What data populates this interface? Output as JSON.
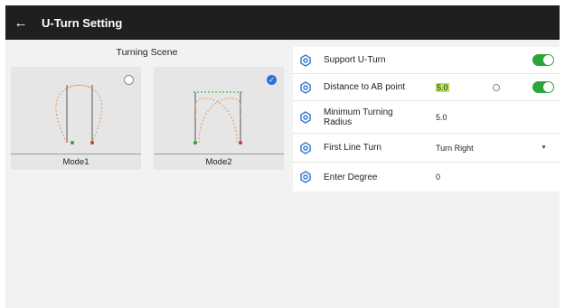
{
  "header": {
    "back_icon": "back-arrow-icon",
    "title": "U-Turn Setting"
  },
  "scene": {
    "title": "Turning Scene",
    "modes": [
      {
        "label": "Mode1",
        "selected": false
      },
      {
        "label": "Mode2",
        "selected": true
      }
    ]
  },
  "settings": {
    "support_uturn": {
      "label": "Support U-Turn",
      "enabled": true
    },
    "distance_ab": {
      "label": "Distance to AB point",
      "value": "5.0",
      "enabled": true
    },
    "min_radius": {
      "label": "Minimum Turning Radius",
      "value": "5.0"
    },
    "first_line_turn": {
      "label": "First Line Turn",
      "value": "Turn Right"
    },
    "enter_degree": {
      "label": "Enter Degree",
      "value": "0"
    }
  },
  "colors": {
    "header_bg": "#1f1f1f",
    "toggle_on": "#2aa63a",
    "selected_radio": "#2f6fe0",
    "settings_icon": "#3a7fd0",
    "path_color": "#e8955a",
    "start_point": "#2aa63a",
    "end_point": "#e03030"
  }
}
